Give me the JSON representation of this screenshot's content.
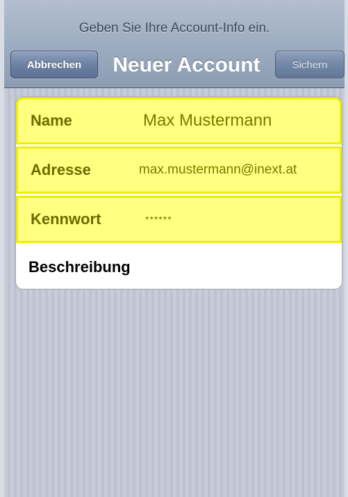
{
  "header": {
    "prompt": "Geben Sie Ihre Account-Info ein.",
    "title": "Neuer Account",
    "cancel_label": "Abbrechen",
    "save_label": "Sichern"
  },
  "form": {
    "fields": [
      {
        "label": "Name",
        "value": "Max Mustermann"
      },
      {
        "label": "Adresse",
        "value": "max.mustermann@inext.at"
      },
      {
        "label": "Kennwort",
        "value": "******"
      },
      {
        "label": "Beschreibung",
        "value": ""
      }
    ]
  },
  "colors": {
    "highlight": "#ffff80",
    "highlight_border": "#eeee00",
    "label_text": "#6b6b00",
    "nav_button": "#6d82a3"
  }
}
